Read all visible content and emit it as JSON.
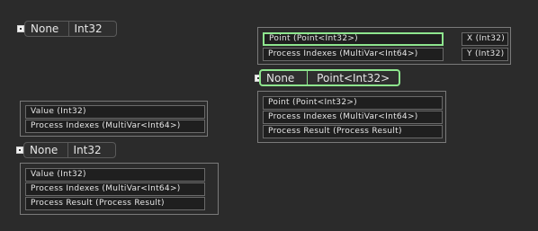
{
  "top_left_pill": {
    "left": "None",
    "right": "Int32"
  },
  "right_top_panel": {
    "rows": [
      "Point (Point<Int32>)",
      "Process Indexes (MultiVar<Int64>)"
    ],
    "side_rows": [
      "X (Int32)",
      "Y (Int32)"
    ]
  },
  "right_pill": {
    "left": "None",
    "right": "Point<Int32>"
  },
  "right_lower_panel": {
    "rows": [
      "Point (Point<Int32>)",
      "Process Indexes (MultiVar<Int64>)",
      "Process Result (Process Result)"
    ]
  },
  "left_mid_panel": {
    "rows": [
      "Value (Int32)",
      "Process Indexes (MultiVar<Int64>)"
    ]
  },
  "left_pill": {
    "left": "None",
    "right": "Int32"
  },
  "left_bottom_panel": {
    "rows": [
      "Value (Int32)",
      "Process Indexes (MultiVar<Int64>)",
      "Process Result (Process Result)"
    ]
  }
}
